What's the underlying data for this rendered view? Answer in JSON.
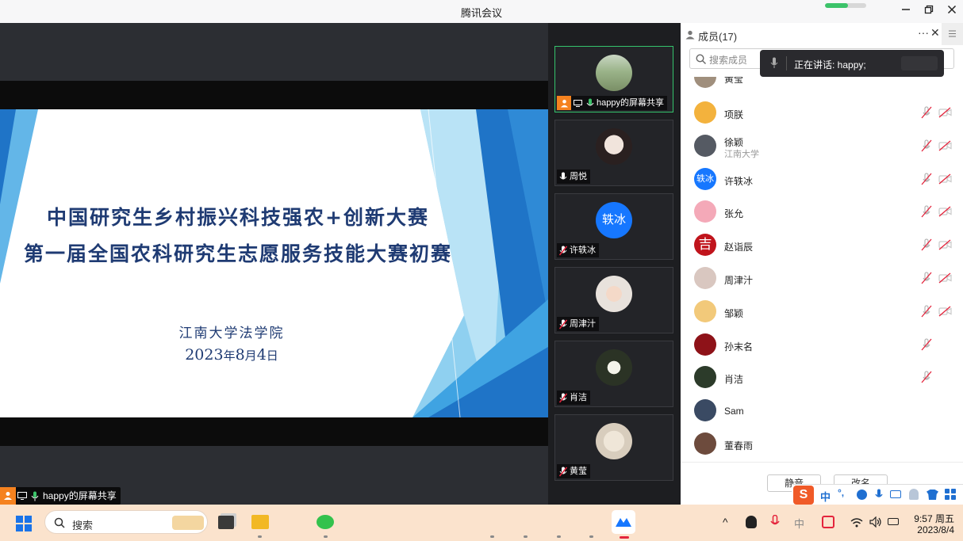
{
  "window": {
    "title": "腾讯会议",
    "minimize_icon": "minimize-icon",
    "restore_icon": "restore-icon",
    "close_icon": "close-icon"
  },
  "slide": {
    "title_line1": "中国研究生乡村振兴科技强农+创新大赛",
    "title_line2": "第一届全国农科研究生志愿服务技能大赛初赛",
    "org": "江南大学法学院",
    "date_num": "2023",
    "date_y": "年",
    "date_month": "8",
    "date_m": "月",
    "date_day": "4",
    "date_d": "日",
    "colors": {
      "accent_dark": "#1f74c7",
      "accent_light": "#63b6e8",
      "text": "#1f3b73"
    }
  },
  "share_label": "happy的屏幕共享",
  "video_tiles": [
    {
      "name": "happy的屏幕共享",
      "active": true,
      "mic": "on",
      "avatar": "photo-path"
    },
    {
      "name": "周悦",
      "active": false,
      "mic": "on",
      "avatar": "photo-girl"
    },
    {
      "name": "许轶冰",
      "active": false,
      "mic": "muted",
      "avatar_text": "轶冰",
      "avatar_color": "#1677ff"
    },
    {
      "name": "周津汁",
      "active": false,
      "mic": "muted",
      "avatar": "photo-woman"
    },
    {
      "name": "肖洁",
      "active": false,
      "mic": "muted",
      "avatar": "photo-flowers"
    },
    {
      "name": "黄莹",
      "active": false,
      "mic": "muted",
      "avatar": "photo-bird"
    }
  ],
  "panel": {
    "title": "成员(17)",
    "more_label": "···",
    "close_label": "✕",
    "search_placeholder": "搜索成员",
    "toast": "正在讲话: happy;",
    "partial_member": "黄莹",
    "members": [
      {
        "name": "项朕",
        "sub": "",
        "mic_muted": true,
        "cam_off": true,
        "avatar_color": "#f3b23d"
      },
      {
        "name": "徐颖",
        "sub": "江南大学",
        "mic_muted": true,
        "cam_off": true,
        "avatar_color": "#555a63"
      },
      {
        "name": "许轶冰",
        "sub": "",
        "mic_muted": true,
        "cam_off": true,
        "avatar_text": "轶冰",
        "avatar_color": "#1677ff"
      },
      {
        "name": "张允",
        "sub": "",
        "mic_muted": true,
        "cam_off": true,
        "avatar_color": "#f4a9b8"
      },
      {
        "name": "赵诣辰",
        "sub": "",
        "mic_muted": true,
        "cam_off": true,
        "avatar_text": "吉",
        "avatar_color": "#c0141c"
      },
      {
        "name": "周津汁",
        "sub": "",
        "mic_muted": true,
        "cam_off": true,
        "avatar_color": "#d9c7c0"
      },
      {
        "name": "邹颖",
        "sub": "",
        "mic_muted": true,
        "cam_off": true,
        "avatar_color": "#f2c97a"
      },
      {
        "name": "孙末名",
        "sub": "",
        "mic_muted": true,
        "cam_off": false,
        "avatar_color": "#8e1218"
      },
      {
        "name": "肖洁",
        "sub": "",
        "mic_muted": true,
        "cam_off": false,
        "avatar_color": "#2c3b2a"
      },
      {
        "name": "Sam",
        "sub": "",
        "mic_muted": false,
        "cam_off": false,
        "avatar_color": "#3a4a63"
      },
      {
        "name": "董春雨",
        "sub": "",
        "mic_muted": false,
        "cam_off": false,
        "avatar_color": "#6d4b3d"
      }
    ],
    "mute_all": "静音",
    "rename": "改名"
  },
  "ime": {
    "lang": "中",
    "punct": "°,",
    "brand": "S"
  },
  "taskbar": {
    "search_placeholder": "搜索",
    "time": "9:57 周五",
    "date": "2023/8/4",
    "chevron": "^"
  }
}
